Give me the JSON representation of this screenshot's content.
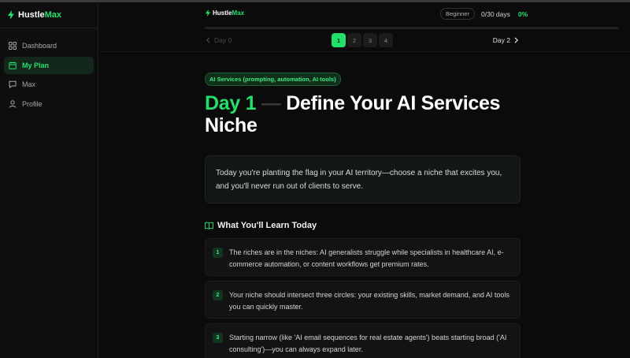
{
  "colors": {
    "accent": "#22e06b",
    "background": "#0b0b0b",
    "sidebar": "#0e0e0e"
  },
  "brand": {
    "name_part1": "Hustle",
    "name_part2": "Max",
    "icon": "lightning-bolt-icon"
  },
  "sidebar": {
    "items": [
      {
        "label": "Dashboard",
        "icon": "grid-icon",
        "active": false
      },
      {
        "label": "My Plan",
        "icon": "calendar-icon",
        "active": true
      },
      {
        "label": "Max",
        "icon": "chat-icon",
        "active": false
      },
      {
        "label": "Profile",
        "icon": "user-icon",
        "active": false
      }
    ]
  },
  "header": {
    "level_badge": "Beginner",
    "days_progress": "0/30 days",
    "percent": "0%",
    "progress_fraction": 0
  },
  "day_nav": {
    "prev_label": "Day 0",
    "next_label": "Day 2",
    "pages": [
      "1",
      "2",
      "3",
      "4"
    ],
    "active_page": "1"
  },
  "lesson": {
    "category": "AI Services (prompting, automation, AI tools)",
    "day_label": "Day 1",
    "dash": "—",
    "title": "Define Your AI Services Niche",
    "intro": "Today you're planting the flag in your AI territory—choose a niche that excites you, and you'll never run out of clients to serve.",
    "learn_heading": "What You'll Learn Today",
    "learn_icon": "book-icon",
    "learn_items": [
      {
        "num": "1",
        "text": "The riches are in the niches: AI generalists struggle while specialists in healthcare AI, e-commerce automation, or content workflows get premium rates."
      },
      {
        "num": "2",
        "text": "Your niche should intersect three circles: your existing skills, market demand, and AI tools you can quickly master."
      },
      {
        "num": "3",
        "text": "Starting narrow (like 'AI email sequences for real estate agents') beats starting broad ('AI consulting')—you can always expand later."
      }
    ]
  }
}
